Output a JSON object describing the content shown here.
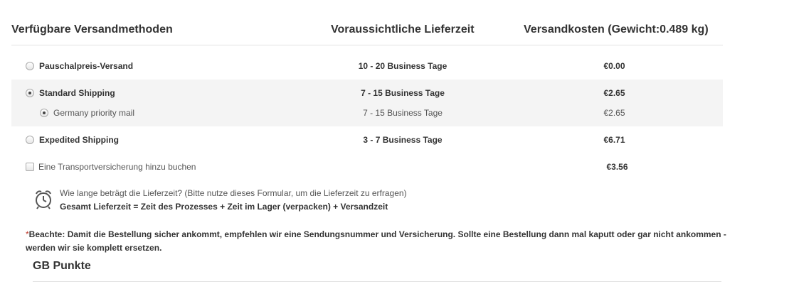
{
  "header": {
    "methods": "Verfügbare Versandmethoden",
    "delivery_time": "Voraussichtliche Lieferzeit",
    "shipping_cost": "Versandkosten (Gewicht:0.489 kg)"
  },
  "rows": [
    {
      "label": "Pauschalpreis-Versand",
      "time": "10 - 20 Business Tage",
      "cost": "€0.00",
      "selected": false
    },
    {
      "label": "Standard Shipping",
      "time": "7 - 15 Business Tage",
      "cost": "€2.65",
      "selected": true
    },
    {
      "label": "Germany priority mail",
      "time": "7 - 15 Business Tage",
      "cost": "€2.65",
      "selected": true
    },
    {
      "label": "Expedited Shipping",
      "time": "3 - 7 Business Tage",
      "cost": "€6.71",
      "selected": false
    }
  ],
  "insurance": {
    "label": "Eine Transportversicherung hinzu buchen",
    "cost": "€3.56",
    "checked": false
  },
  "info": {
    "line1": "Wie lange beträgt die Lieferzeit? (Bitte nutze dieses Formular, um die Lieferzeit zu erfragen)",
    "line2": "Gesamt Lieferzeit = Zeit des Prozesses + Zeit im Lager (verpacken) + Versandzeit"
  },
  "note": {
    "star": "*",
    "text": "Beachte: Damit die Bestellung sicher ankommt, empfehlen wir eine Sendungsnummer und Versicherung. Sollte eine Bestellung dann mal kaputt oder gar nicht ankommen - werden wir sie komplett ersetzen."
  },
  "gb_title": "GB Punkte",
  "icons": {
    "clock": "alarm-clock-icon"
  }
}
